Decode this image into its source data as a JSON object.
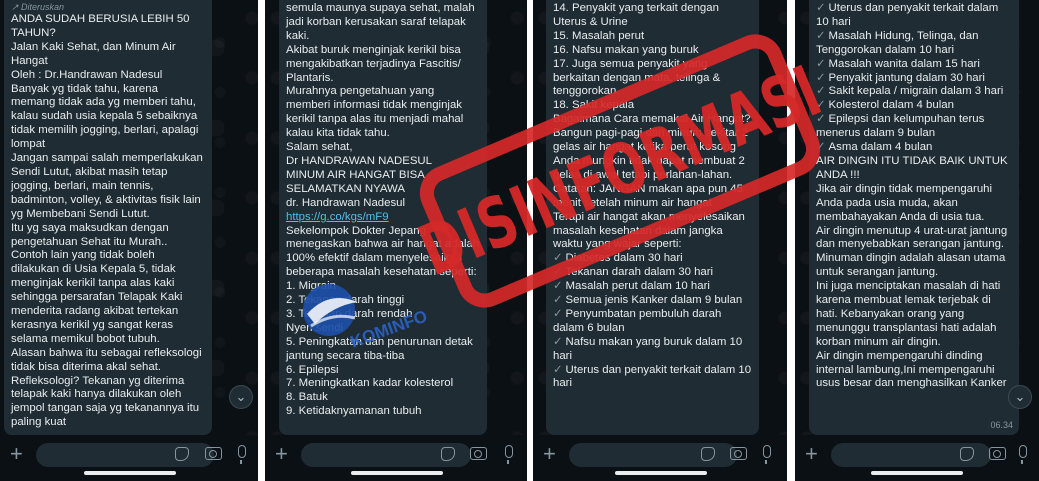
{
  "panel1": {
    "forwarded_label": "↗ Diteruskan",
    "message_lines": [
      "ANDA SUDAH BERUSIA LEBIH 50 TAHUN?",
      "Jalan Kaki Sehat, dan Minum Air Hangat",
      "Oleh : Dr.Handrawan Nadesul",
      "Banyak yg tidak tahu, karena memang tidak ada yg memberi tahu, kalau sudah usia kepala 5 sebaiknya tidak memilih jogging, berlari, apalagi lompat",
      "Jangan sampai salah memperlakukan Sendi Lutut, akibat masih tetap jogging, berlari, main tennis, badminton, volley, & aktivitas fisik lain yg Membebani Sendi Lutut.",
      "Itu yg saya maksudkan dengan pengetahuan Sehat itu Murah..",
      "Contoh lain yang tidak boleh dilakukan di Usia Kepala 5, tidak menginjak kerikil tanpa alas kaki sehingga persarafan Telapak Kaki menderita radang akibat tertekan kerasnya kerikil yg sangat keras selama memikul bobot tubuh.",
      "Alasan bahwa itu sebagai refleksologi tidak bisa diterima akal sehat. Refleksologi? Tekanan yg diterima telapak kaki hanya dilakukan oleh jempol tangan saja yg tekanannya itu paling kuat"
    ]
  },
  "panel2": {
    "message_lines": [
      "semula maunya supaya sehat, malah jadi korban kerusakan saraf telapak kaki.",
      "Akibat buruk menginjak kerikil bisa mengakibatkan terjadinya Fascitis/ Plantaris.",
      "Murahnya pengetahuan yang memberi informasi tidak menginjak kerikil tanpa alas itu menjadi mahal kalau kita tidak tahu.",
      "Salam sehat,",
      "Dr HANDRAWAN NADESUL",
      "MINUM AIR HANGAT BISA SELAMATKAN NYAWA",
      "Sekelompok Dokter Jepang menegaskan bahwa air hangat adalah 100% efektif dalam menyelesaikan beberapa masalah kesehatan seperti:",
      "1. Migrain",
      "2. Tekanan darah tinggi",
      "3. Tekanan darah rendah",
      "Nyeri sendi",
      "5. Peningkatan dan penurunan detak jantung secara tiba-tiba",
      "6. Epilepsi",
      "7. Meningkatkan kadar kolesterol",
      "8. Batuk",
      "9. Ketidaknyamanan tubuh"
    ],
    "link_prefix": "dr. Handrawan Nadesul ",
    "link_text": "https://g.co/kgs/mF9"
  },
  "panel3": {
    "message_lines": [
      "14. Penyakit yang terkait dengan Uterus & Urine",
      "15. Masalah perut",
      "16. Nafsu makan yang buruk",
      "17. Juga semua penyakit yang berkaitan dengan mata, telinga & tenggorokan.",
      "18. Sakit kepala",
      "Bagaimana Cara memakai Air Hangat?",
      "Bangun pagi-pagi dan minum sekitar 2 gelas air hangat ketika perut kosong",
      "Anda mungkin tidak dapat membuat 2 gelas di awal tetapi perlahan-lahan.",
      "Catatan: JANGAN makan apa pun 45 menit setelah minum air hangat",
      "Terapi air hangat akan menyelesaikan masalah kesehatan dalam jangka waktu yang wajar seperti:"
    ],
    "checklist": [
      "Diabetes dalam 30 hari",
      "Tekanan darah dalam 30 hari",
      "Masalah perut dalam 10 hari",
      "Semua jenis Kanker dalam 9 bulan",
      "Penyumbatan pembuluh darah dalam 6 bulan",
      "Nafsu makan yang buruk dalam 10 hari",
      "Uterus dan penyakit terkait dalam 10 hari"
    ]
  },
  "panel4": {
    "checklist": [
      "Uterus dan penyakit terkait dalam 10 hari",
      "Masalah Hidung, Telinga, dan Tenggorokan dalam 10 hari",
      "Masalah wanita dalam 15 hari",
      "Penyakit jantung dalam 30 hari",
      "Sakit kepala / migrain dalam 3 hari",
      "Kolesterol dalam 4 bulan",
      "Epilepsi dan kelumpuhan terus menerus dalam 9 bulan",
      "Asma dalam 4 bulan"
    ],
    "message_lines": [
      "AIR DINGIN ITU TIDAK BAIK UNTUK ANDA !!!",
      "Jika air dingin tidak mempengaruhi Anda pada usia muda, akan membahayakan Anda di usia tua.",
      "Air dingin menutup 4 urat-urat jantung dan menyebabkan serangan jantung. Minuman dingin adalah alasan utama untuk serangan jantung.",
      "Ini juga menciptakan masalah di hati karena membuat lemak terjebak di hati. Kebanyakan orang yang menunggu transplantasi hati adalah korban minum air dingin.",
      "Air dingin mempengaruhi dinding internal lambung,Ini mempengaruhi usus besar dan menghasilkan Kanker"
    ],
    "timestamp": "06.34"
  },
  "stamp_text": "DISINFORMASI",
  "logo_text": "KOMINFO",
  "icons": [
    "plus-icon",
    "sticker-icon",
    "camera-icon",
    "mic-icon",
    "chevron-down-icon",
    "check-icon"
  ],
  "colors": {
    "chat_bg": "#0b1014",
    "bubble": "#1f2c33",
    "text": "#e9edef",
    "stamp": "#d62828",
    "link": "#53bdeb"
  }
}
